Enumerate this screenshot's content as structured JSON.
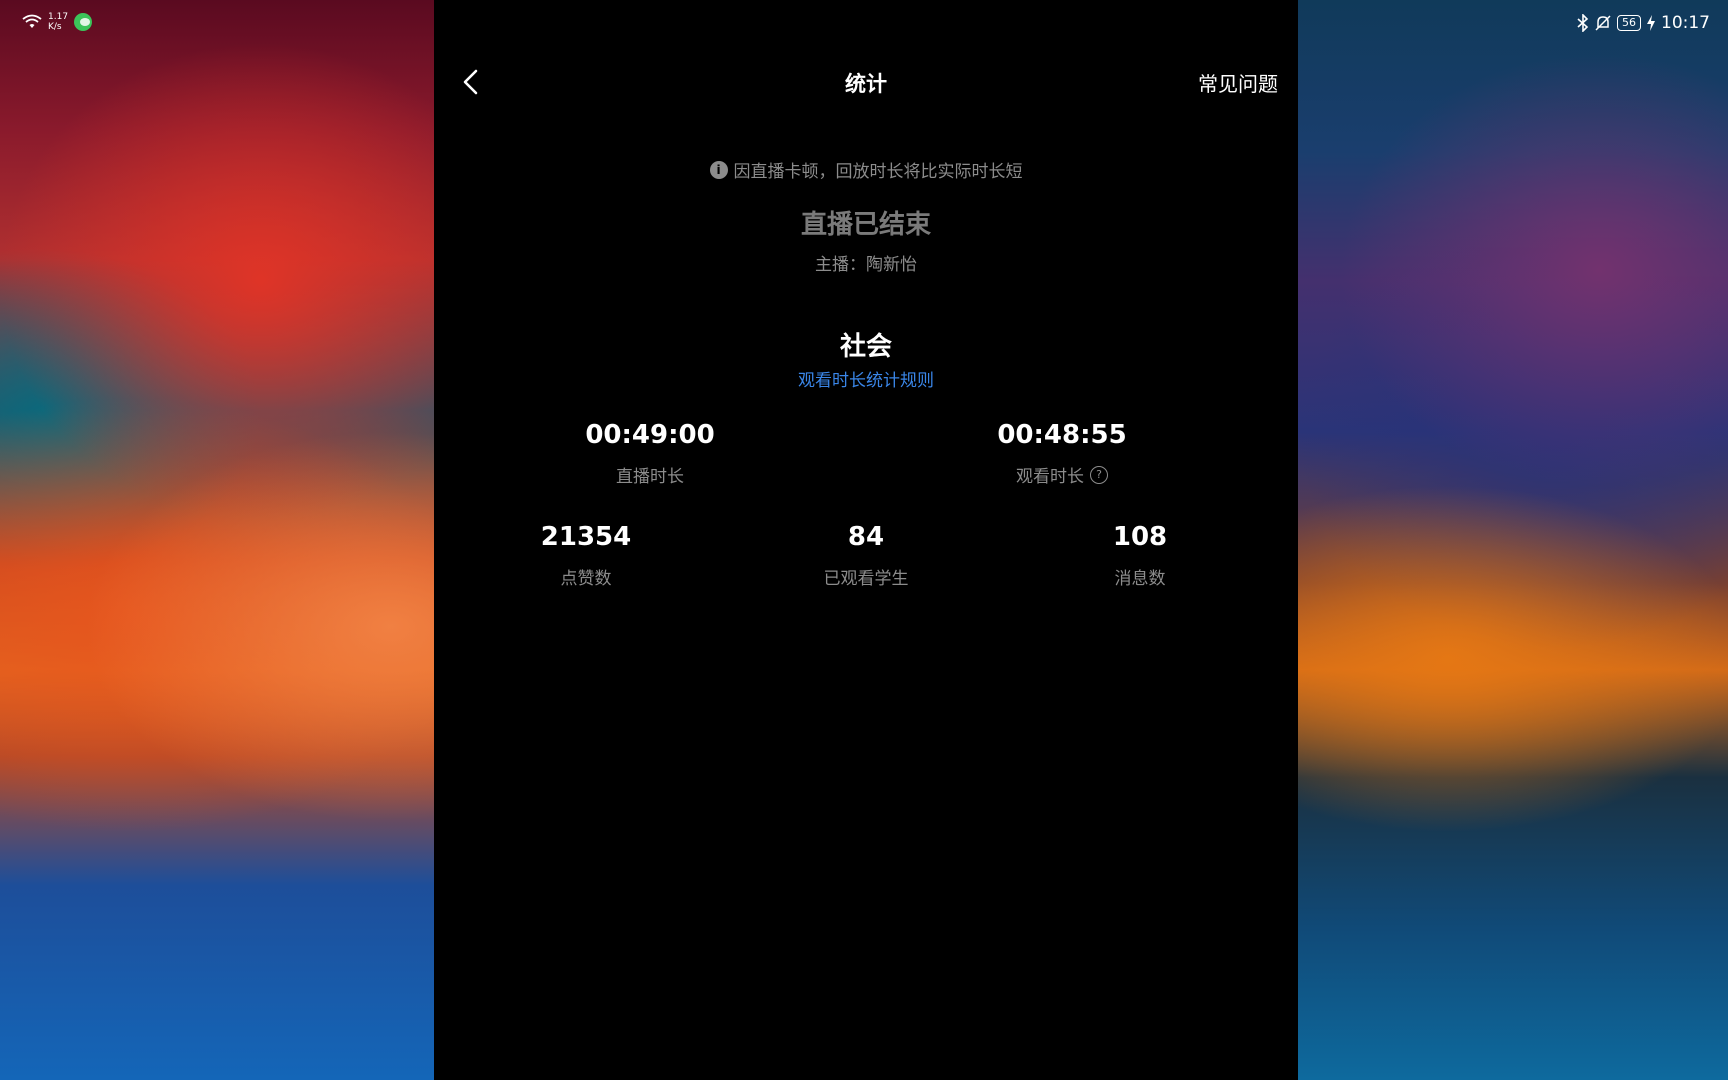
{
  "status_bar": {
    "net_speed_value": "1.17",
    "net_speed_unit": "K/s",
    "battery": "56",
    "time": "10:17"
  },
  "header": {
    "title": "统计",
    "faq_label": "常见问题"
  },
  "notice": "因直播卡顿，回放时长将比实际时长短",
  "status": "直播已结束",
  "host": "主播：陶新怡",
  "course": "社会",
  "rules_link": "观看时长统计规则",
  "stats": {
    "live_duration": {
      "value": "00:49:00",
      "label": "直播时长"
    },
    "watch_duration": {
      "value": "00:48:55",
      "label": "观看时长"
    },
    "likes": {
      "value": "21354",
      "label": "点赞数"
    },
    "watched_students": {
      "value": "84",
      "label": "已观看学生"
    },
    "messages": {
      "value": "108",
      "label": "消息数"
    }
  },
  "colors": {
    "link": "#3a86e8",
    "muted": "#8c8c8c",
    "panel_bg": "#000000"
  }
}
